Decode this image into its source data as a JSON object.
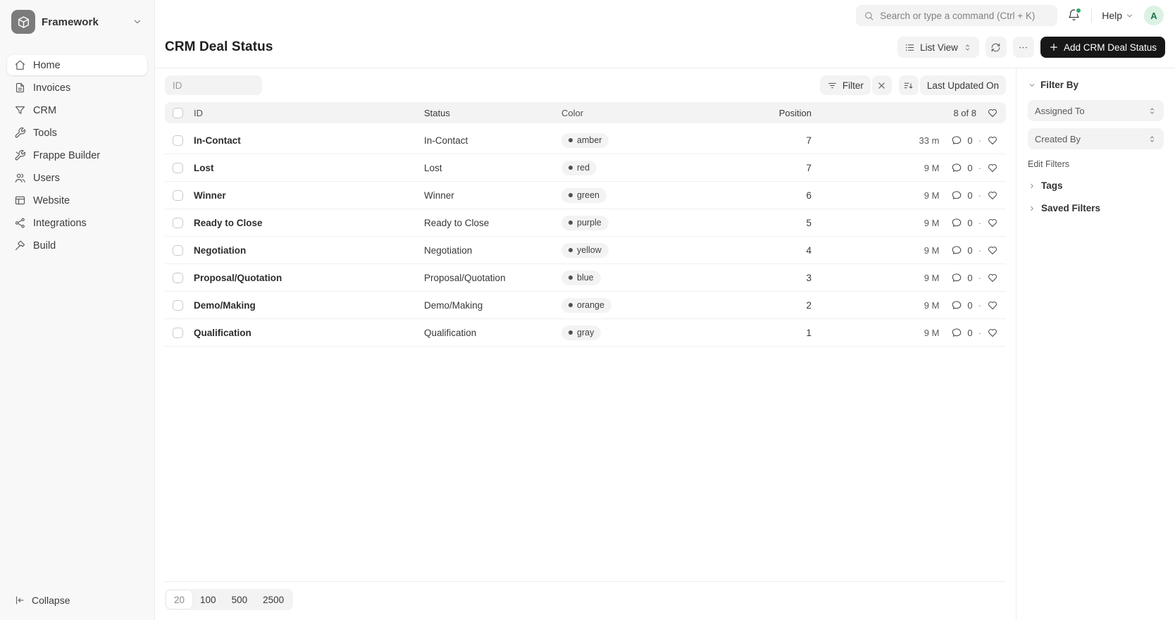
{
  "brand": {
    "name": "Framework",
    "logo_icon": "cube-icon"
  },
  "topbar": {
    "search_placeholder": "Search or type a command (Ctrl + K)",
    "help_label": "Help",
    "avatar_initial": "A"
  },
  "sidebar": {
    "items": [
      {
        "label": "Home",
        "icon": "home",
        "active": true
      },
      {
        "label": "Invoices",
        "icon": "invoices"
      },
      {
        "label": "CRM",
        "icon": "crm"
      },
      {
        "label": "Tools",
        "icon": "tools"
      },
      {
        "label": "Frappe Builder",
        "icon": "builder"
      },
      {
        "label": "Users",
        "icon": "users"
      },
      {
        "label": "Website",
        "icon": "website"
      },
      {
        "label": "Integrations",
        "icon": "integrations"
      },
      {
        "label": "Build",
        "icon": "build"
      }
    ],
    "collapse_label": "Collapse"
  },
  "header": {
    "title": "CRM Deal Status",
    "view_switcher_label": "List View",
    "add_button_label": "Add CRM Deal Status"
  },
  "toolbar": {
    "id_filter_placeholder": "ID",
    "filter_label": "Filter",
    "sort_label": "Last Updated On"
  },
  "table": {
    "columns": {
      "id": "ID",
      "status": "Status",
      "color": "Color",
      "position": "Position"
    },
    "count_label": "8 of 8",
    "rows": [
      {
        "id": "In-Contact",
        "status": "In-Contact",
        "color": "amber",
        "position": "7",
        "modified": "33 m",
        "comments": "0"
      },
      {
        "id": "Lost",
        "status": "Lost",
        "color": "red",
        "position": "7",
        "modified": "9 M",
        "comments": "0"
      },
      {
        "id": "Winner",
        "status": "Winner",
        "color": "green",
        "position": "6",
        "modified": "9 M",
        "comments": "0"
      },
      {
        "id": "Ready to Close",
        "status": "Ready to Close",
        "color": "purple",
        "position": "5",
        "modified": "9 M",
        "comments": "0"
      },
      {
        "id": "Negotiation",
        "status": "Negotiation",
        "color": "yellow",
        "position": "4",
        "modified": "9 M",
        "comments": "0"
      },
      {
        "id": "Proposal/Quotation",
        "status": "Proposal/Quotation",
        "color": "blue",
        "position": "3",
        "modified": "9 M",
        "comments": "0"
      },
      {
        "id": "Demo/Making",
        "status": "Demo/Making",
        "color": "orange",
        "position": "2",
        "modified": "9 M",
        "comments": "0"
      },
      {
        "id": "Qualification",
        "status": "Qualification",
        "color": "gray",
        "position": "1",
        "modified": "9 M",
        "comments": "0"
      }
    ]
  },
  "filter_panel": {
    "title": "Filter By",
    "assigned_to_label": "Assigned To",
    "created_by_label": "Created By",
    "edit_filters_label": "Edit Filters",
    "tags_label": "Tags",
    "saved_filters_label": "Saved Filters"
  },
  "footer": {
    "page_sizes": [
      {
        "label": "20",
        "active": true
      },
      {
        "label": "100"
      },
      {
        "label": "500"
      },
      {
        "label": "2500"
      }
    ]
  },
  "colors": {
    "primary_button_bg": "#171717",
    "sidebar_bg": "#f8f8f8",
    "chip_bg": "#f3f3f3",
    "border": "#ededed",
    "avatar_bg": "#daf2e2",
    "avatar_text": "#20714a",
    "notification_dot": "#30a66d",
    "tag_dot": "#4f4f4f"
  }
}
